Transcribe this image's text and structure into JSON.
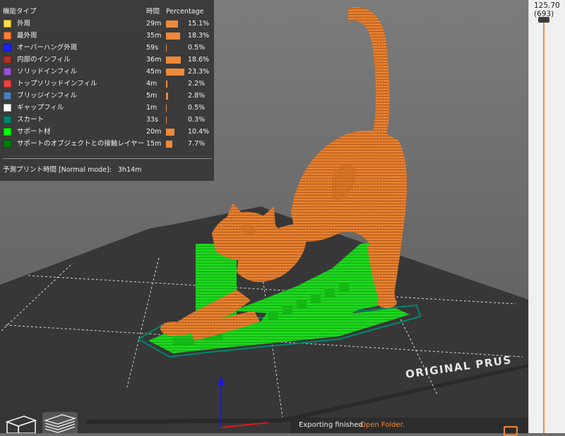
{
  "legend": {
    "headers": {
      "feature": "機能タイプ",
      "time": "時間",
      "percentage": "Percentage"
    },
    "rows": [
      {
        "name": "外周",
        "time": "29m",
        "percent": "15.1%",
        "fraction": 0.151,
        "color": "#ffe04a"
      },
      {
        "name": "最外周",
        "time": "35m",
        "percent": "18.3%",
        "fraction": 0.183,
        "color": "#ff7d38"
      },
      {
        "name": "オーバーハング外周",
        "time": "59s",
        "percent": "0.5%",
        "fraction": 0.005,
        "color": "#1f1fff"
      },
      {
        "name": "内部のインフィル",
        "time": "36m",
        "percent": "18.6%",
        "fraction": 0.186,
        "color": "#b03029"
      },
      {
        "name": "ソリッドインフィル",
        "time": "45m",
        "percent": "23.3%",
        "fraction": 0.233,
        "color": "#9654cc"
      },
      {
        "name": "トップソリッドインフィル",
        "time": "4m",
        "percent": "2.2%",
        "fraction": 0.022,
        "color": "#f04040"
      },
      {
        "name": "ブリッジインフィル",
        "time": "5m",
        "percent": "2.8%",
        "fraction": 0.028,
        "color": "#4d80ba"
      },
      {
        "name": "ギャップフィル",
        "time": "1m",
        "percent": "0.5%",
        "fraction": 0.005,
        "color": "#ffffff"
      },
      {
        "name": "スカート",
        "time": "33s",
        "percent": "0.3%",
        "fraction": 0.003,
        "color": "#00876e"
      },
      {
        "name": "サポート材",
        "time": "20m",
        "percent": "10.4%",
        "fraction": 0.104,
        "color": "#00ff00"
      },
      {
        "name": "サポートのオブジェクトとの接触レイヤー",
        "time": "15m",
        "percent": "7.7%",
        "fraction": 0.077,
        "color": "#008000"
      }
    ],
    "print_time_label": "予測プリント時間 [Normal mode]:",
    "print_time_value": "3h14m"
  },
  "slider": {
    "top_value": "125.70",
    "top_layer": "(693)"
  },
  "bed": {
    "brand_text": "ORIGINAL PRUS"
  },
  "notification": {
    "text": "Exporting finished.",
    "link": "Open Folder."
  },
  "icons": {
    "view_3d": "cube-icon",
    "view_layers": "layers-icon",
    "close": "close-icon"
  },
  "colors": {
    "model": "#e07a2c",
    "support": "#1ed61e",
    "bed": "#373737",
    "accent": "#f08a3a"
  }
}
